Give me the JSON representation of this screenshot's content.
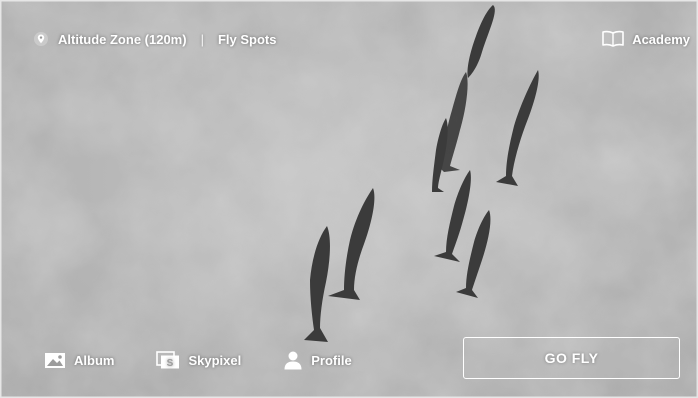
{
  "top_bar": {
    "location_icon": "map-pin-icon",
    "altitude_zone": "Altitude Zone (120m)",
    "separator": "|",
    "fly_spots": "Fly Spots",
    "academy_icon": "book-icon",
    "academy": "Academy"
  },
  "background": {
    "subject": "dolphins-swimming-aerial-view",
    "tone": "#b8b8b8"
  },
  "bottom_nav": {
    "items": [
      {
        "icon": "image-icon",
        "label": "Album"
      },
      {
        "icon": "skypixel-icon",
        "label": "Skypixel"
      },
      {
        "icon": "person-icon",
        "label": "Profile"
      }
    ]
  },
  "primary_action": {
    "label": "GO FLY"
  },
  "colors": {
    "text": "#ffffff",
    "water": "#b8b8b8",
    "dolphin": "#3a3a3a"
  }
}
